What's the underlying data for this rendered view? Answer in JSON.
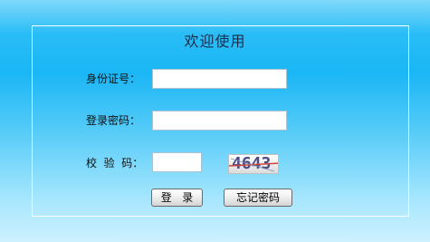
{
  "page": {
    "title": "欢迎使用"
  },
  "form": {
    "id_label": "身份证号：",
    "id_value": "",
    "password_label": "登录密码：",
    "password_value": "",
    "captcha_label": "校  验  码：",
    "captcha_value": "",
    "captcha_image_text": "4643"
  },
  "buttons": {
    "login_label": "登   录",
    "forgot_label": "忘记密码"
  },
  "colors": {
    "background_top": "#29bdf6",
    "background_bottom": "#cdf1ff",
    "panel_border": "#ffffff",
    "title_text": "#1d2b4a"
  }
}
